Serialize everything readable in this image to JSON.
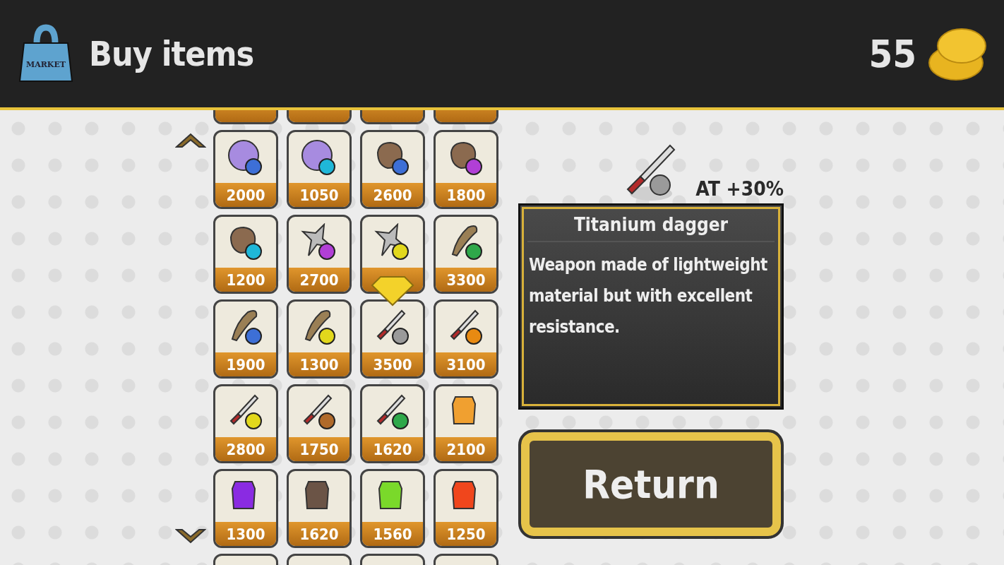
{
  "header": {
    "bag_label": "MARKET",
    "title": "Buy items",
    "coins": "55"
  },
  "items": [
    {
      "kind": "orb",
      "color": "#3d6fd6",
      "price": "2000",
      "selected": false
    },
    {
      "kind": "orb",
      "color": "#1fb7d8",
      "price": "1050",
      "selected": false
    },
    {
      "kind": "glove",
      "color": "#3d6fd6",
      "price": "2600",
      "selected": false
    },
    {
      "kind": "glove",
      "color": "#b13fd6",
      "price": "1800",
      "selected": false
    },
    {
      "kind": "glove",
      "color": "#1fb7d8",
      "price": "1200",
      "selected": false
    },
    {
      "kind": "shuriken",
      "color": "#b13fd6",
      "price": "2700",
      "selected": false
    },
    {
      "kind": "shuriken",
      "color": "#e2d81c",
      "selected": false
    },
    {
      "kind": "club",
      "color": "#2fa84a",
      "price": "3300",
      "selected": false
    },
    {
      "kind": "club",
      "color": "#3d6fd6",
      "price": "1900",
      "selected": false
    },
    {
      "kind": "club",
      "color": "#e2d81c",
      "price": "1300",
      "selected": false
    },
    {
      "kind": "dagger",
      "color": "#9a9a9a",
      "price": "3500",
      "selected": true
    },
    {
      "kind": "dagger",
      "color": "#e88a12",
      "price": "3100",
      "selected": false
    },
    {
      "kind": "dagger",
      "color": "#e2d81c",
      "price": "2800",
      "selected": false
    },
    {
      "kind": "dagger",
      "color": "#b06a2a",
      "price": "1750",
      "selected": false
    },
    {
      "kind": "dagger",
      "color": "#2fa84a",
      "price": "1620",
      "selected": false
    },
    {
      "kind": "vest",
      "color": "#f0a030",
      "price": "2100",
      "selected": false
    },
    {
      "kind": "vest",
      "color": "#8a2be2",
      "price": "1300",
      "selected": false
    },
    {
      "kind": "vest",
      "color": "#6b5446",
      "price": "1620",
      "selected": false
    },
    {
      "kind": "vest",
      "color": "#7ad92a",
      "price": "1560",
      "selected": false
    },
    {
      "kind": "vest",
      "color": "#f0461c",
      "price": "1250",
      "selected": false
    }
  ],
  "detail": {
    "stat": "AT +30%",
    "name": "Titanium dagger",
    "description": "Weapon made of lightweight material but with excellent resistance."
  },
  "return_button": "Return"
}
